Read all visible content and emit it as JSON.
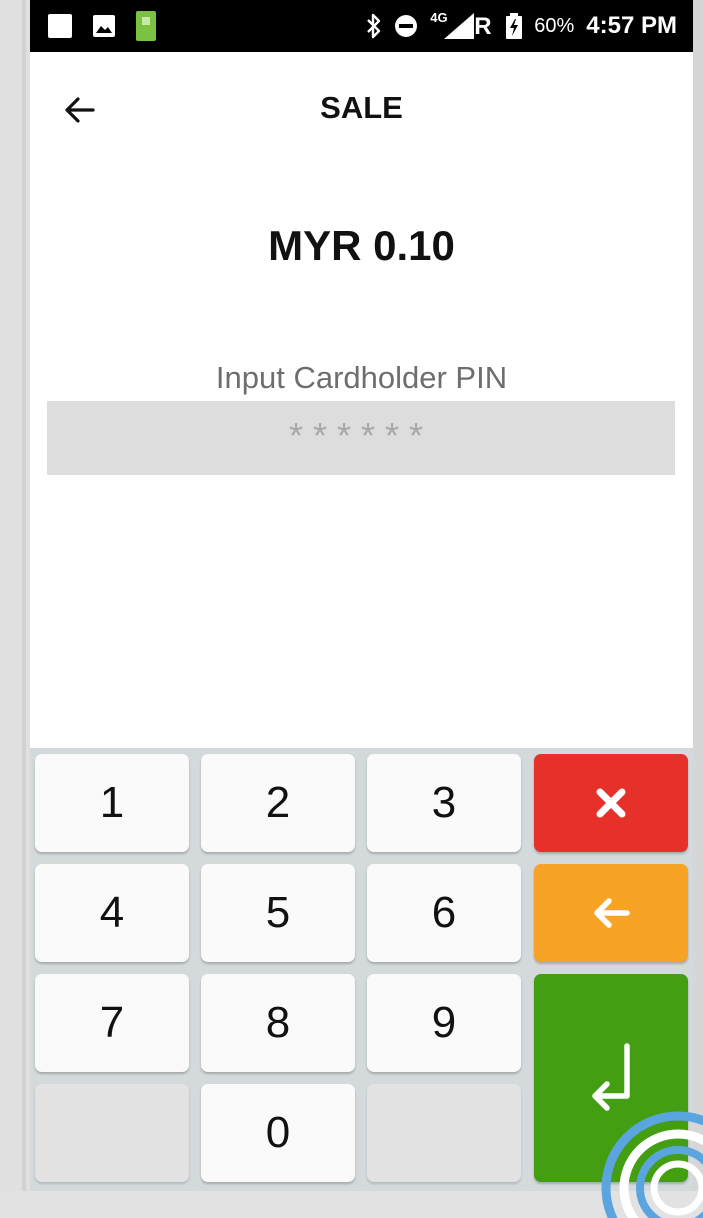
{
  "status_bar": {
    "battery_percent": "60%",
    "network": "4G",
    "roaming": "R",
    "time": "4:57 PM",
    "icons": [
      "square-notification-icon",
      "image-icon",
      "app-notification-icon",
      "bluetooth-icon",
      "do-not-disturb-icon",
      "signal-icon",
      "battery-charging-icon"
    ]
  },
  "header": {
    "title": "SALE",
    "back_icon": "arrow-left-icon"
  },
  "amount": "MYR 0.10",
  "pin": {
    "label": "Input Cardholder PIN",
    "masked_value": "******"
  },
  "keypad": {
    "keys": [
      "1",
      "2",
      "3",
      "4",
      "5",
      "6",
      "7",
      "8",
      "9",
      "0"
    ],
    "actions": {
      "cancel": {
        "icon": "x-icon",
        "color": "#e7302a"
      },
      "backspace": {
        "icon": "arrow-left-icon",
        "color": "#f6a326"
      },
      "enter": {
        "icon": "enter-return-icon",
        "color": "#449e12"
      }
    }
  },
  "colors": {
    "pin_field_bg": "#dddddd",
    "keypad_bg": "#d4d9dc"
  }
}
